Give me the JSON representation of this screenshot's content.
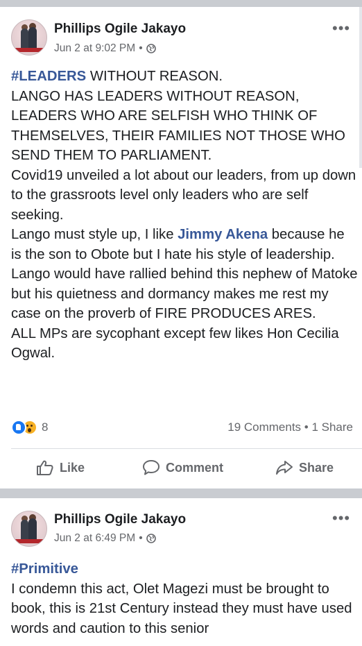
{
  "posts": [
    {
      "author": "Phillips Ogile Jakayo",
      "time": "Jun 2 at 9:02 PM",
      "more_label": "•••",
      "body": [
        {
          "tag": "#LEADERS",
          "rest": " WITHOUT REASON."
        },
        {
          "text": "LANGO HAS LEADERS WITHOUT REASON, LEADERS WHO ARE SELFISH WHO THINK OF THEMSELVES, THEIR FAMILIES NOT THOSE WHO SEND THEM TO PARLIAMENT."
        },
        {
          "text": "Covid19 unveiled a lot about our leaders, from up down to the grassroots level only leaders who are self seeking."
        },
        {
          "pre": "Lango must style up, I like ",
          "mention": "Jimmy Akena",
          "rest": " because he is the son to Obote but I hate his style of leadership."
        },
        {
          "text": "Lango would have rallied behind this nephew of Matoke but his quietness and dormancy makes me rest my case on the proverb of FIRE PRODUCES ARES."
        },
        {
          "text": "ALL MPs are sycophant except few likes Hon Cecilia Ogwal."
        }
      ],
      "reaction_count": "8",
      "comments_shares": "19 Comments • 1 Share",
      "actions": {
        "like": "Like",
        "comment": "Comment",
        "share": "Share"
      }
    },
    {
      "author": "Phillips Ogile Jakayo",
      "time": "Jun 2 at 6:49 PM",
      "more_label": "•••",
      "body": [
        {
          "tag": "#Primitive",
          "rest": ""
        },
        {
          "text": "I condemn this act, Olet Magezi must be brought to book, this is 21st Century instead they must have used words and caution to this senior"
        }
      ]
    }
  ],
  "colors": {
    "link": "#385898",
    "secondary_text": "#65676b",
    "separator": "#c9ccd1",
    "like_blue": "#1877f2",
    "wow_yellow": "#f7b125"
  },
  "icons": [
    "avatar",
    "more-options-icon",
    "globe-icon",
    "like-reaction-icon",
    "wow-reaction-icon",
    "like-thumb-icon",
    "comment-bubble-icon",
    "share-arrow-icon"
  ]
}
